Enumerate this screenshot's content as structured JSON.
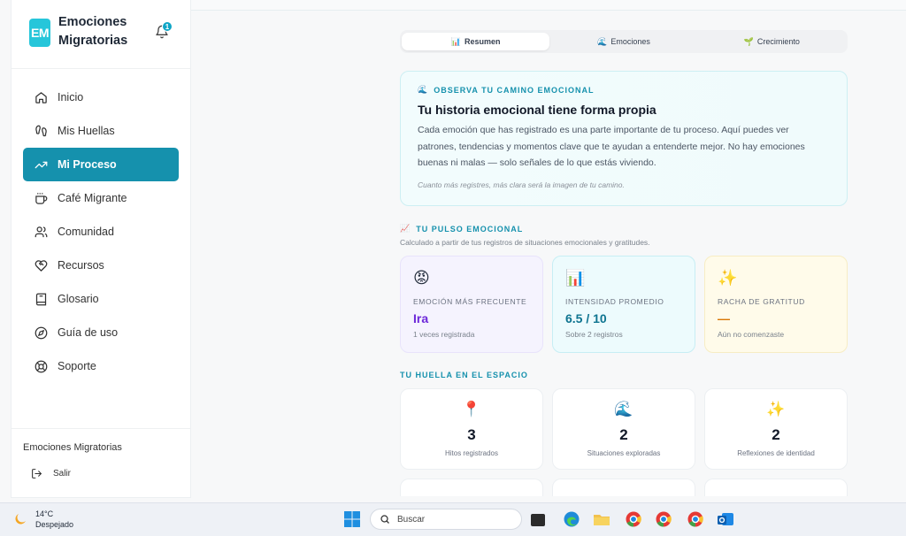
{
  "brand": {
    "logo": "EM",
    "name": "Emociones Migratorias",
    "notifications": "1"
  },
  "nav": [
    {
      "label": "Inicio",
      "icon": "home-icon",
      "active": false
    },
    {
      "label": "Mis Huellas",
      "icon": "footprints-icon",
      "active": false
    },
    {
      "label": "Mi Proceso",
      "icon": "trending-up-icon",
      "active": true
    },
    {
      "label": "Café Migrante",
      "icon": "coffee-icon",
      "active": false
    },
    {
      "label": "Comunidad",
      "icon": "users-icon",
      "active": false
    },
    {
      "label": "Recursos",
      "icon": "heart-hand-icon",
      "active": false
    },
    {
      "label": "Glosario",
      "icon": "book-icon",
      "active": false
    },
    {
      "label": "Guía de uso",
      "icon": "compass-icon",
      "active": false
    },
    {
      "label": "Soporte",
      "icon": "lifebuoy-icon",
      "active": false
    }
  ],
  "sidebar_footer": {
    "org": "Emociones Migratorias",
    "logout": "Salir"
  },
  "tabs": [
    {
      "label": "Resumen",
      "icon": "📊",
      "active": true
    },
    {
      "label": "Emociones",
      "icon": "🌊",
      "active": false
    },
    {
      "label": "Crecimiento",
      "icon": "🌱",
      "active": false
    }
  ],
  "hero": {
    "kicker": "OBSERVA TU CAMINO EMOCIONAL",
    "kicker_icon": "🌊",
    "title": "Tu historia emocional tiene forma propia",
    "body": "Cada emoción que has registrado es una parte importante de tu proceso. Aquí puedes ver patrones, tendencias y momentos clave que te ayudan a entenderte mejor. No hay emociones buenas ni malas — solo señales de lo que estás viviendo.",
    "note": "Cuanto más registres, más clara será la imagen de tu camino."
  },
  "pulse": {
    "kicker": "TU PULSO EMOCIONAL",
    "kicker_icon": "📈",
    "subtitle": "Calculado a partir de tus registros de situaciones emocionales y gratitudes.",
    "cards": [
      {
        "emoji": "😡",
        "label": "EMOCIÓN MÁS FRECUENTE",
        "value": "Ira",
        "sub": "1 veces registrada",
        "color": "#6d28d9"
      },
      {
        "emoji": "📊",
        "label": "INTENSIDAD PROMEDIO",
        "value": "6.5 / 10",
        "sub": "Sobre 2 registros",
        "color": "#0e7490"
      },
      {
        "emoji": "✨",
        "label": "RACHA DE GRATITUD",
        "value": "—",
        "sub": "Aún no comenzaste",
        "color": "#d97706"
      }
    ]
  },
  "footprint": {
    "kicker": "TU HUELLA EN EL ESPACIO",
    "stats": [
      {
        "emoji": "📍",
        "value": "3",
        "caption": "Hitos registrados"
      },
      {
        "emoji": "🌊",
        "value": "2",
        "caption": "Situaciones exploradas"
      },
      {
        "emoji": "✨",
        "value": "2",
        "caption": "Reflexiones de identidad"
      }
    ]
  },
  "taskbar": {
    "temp": "14°C",
    "condition": "Despejado",
    "search_placeholder": "Buscar"
  }
}
